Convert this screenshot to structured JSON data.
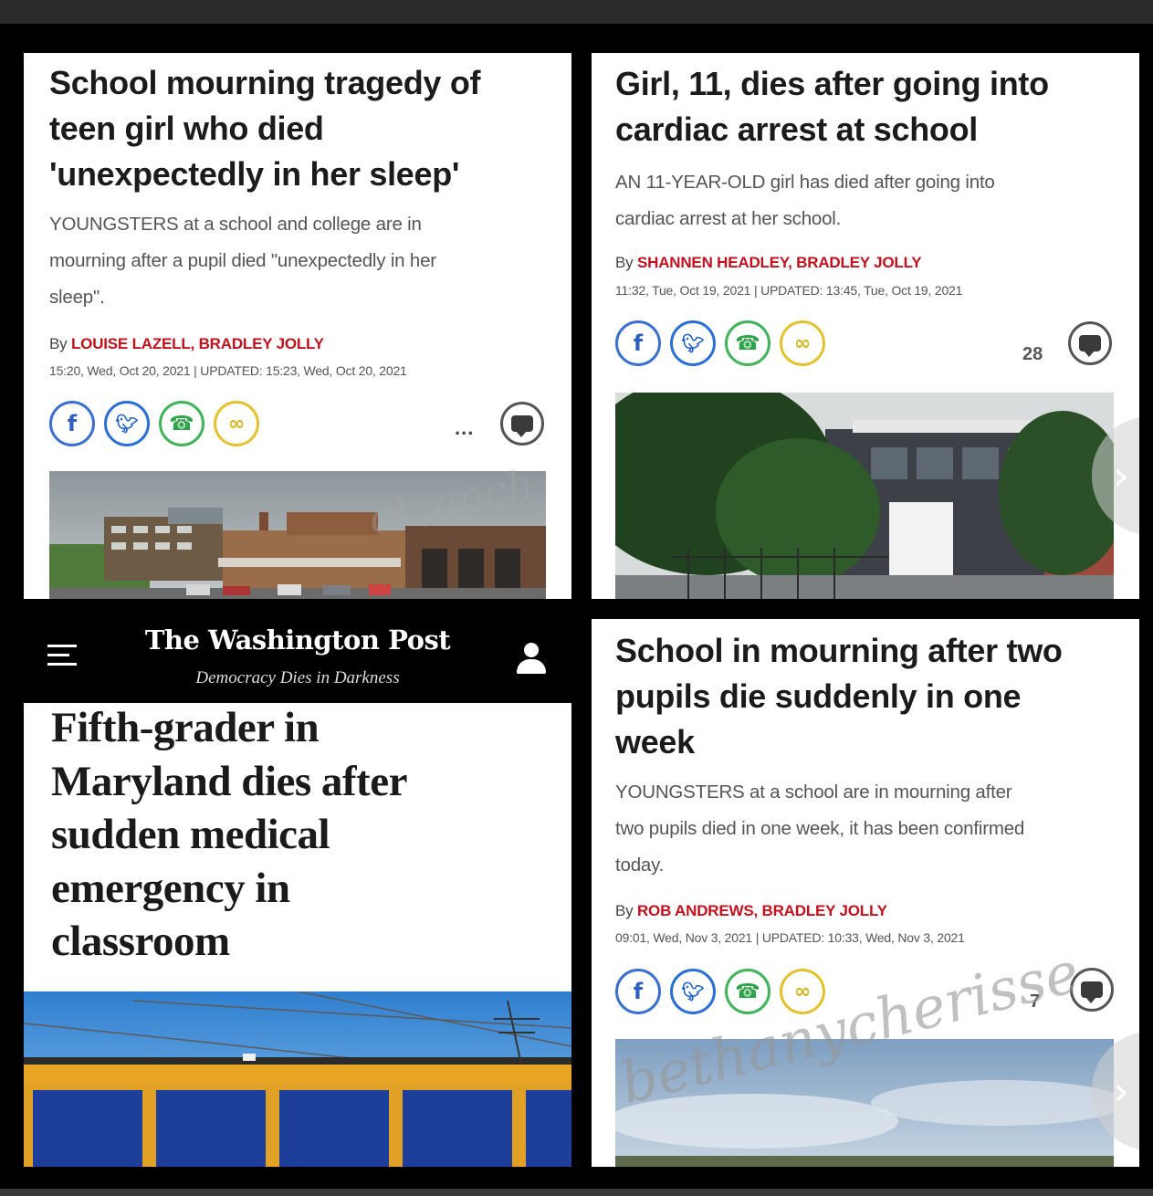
{
  "articles": [
    {
      "headline_lines": [
        "School mourning tragedy of",
        "teen girl who died",
        "'unexpectedly in her sleep'"
      ],
      "standfirst_lines": [
        "YOUNGSTERS at a school and college are in",
        "mourning after a pupil died \"unexpectedly in her",
        "sleep\"."
      ],
      "byline_prefix": "By",
      "authors": "LOUISE LAZELL, BRADLEY JOLLY",
      "timestamp": "15:20, Wed, Oct 20, 2021 | UPDATED: 15:23, Wed, Oct 20, 2021",
      "more": "...",
      "comment_count": ""
    },
    {
      "headline_lines": [
        "Girl, 11, dies after going into",
        "cardiac arrest at school"
      ],
      "standfirst_lines": [
        "AN 11-YEAR-OLD girl has died after going into",
        "cardiac arrest at her school."
      ],
      "byline_prefix": "By",
      "authors": "SHANNEN HEADLEY, BRADLEY JOLLY",
      "timestamp": "11:32, Tue, Oct 19, 2021 | UPDATED: 13:45, Tue, Oct 19, 2021",
      "comment_count": "28"
    },
    {
      "headline_lines": [
        "School in mourning after two",
        "pupils die suddenly in one",
        "week"
      ],
      "standfirst_lines": [
        "YOUNGSTERS at a school are in mourning after",
        "two pupils died in one week, it has been confirmed",
        "today."
      ],
      "byline_prefix": "By",
      "authors": "ROB ANDREWS, BRADLEY JOLLY",
      "timestamp": "09:01, Wed, Nov 3, 2021 | UPDATED: 10:33, Wed, Nov 3, 2021",
      "comment_count": "7"
    }
  ],
  "share_icons": [
    "facebook-icon",
    "twitter-icon",
    "whatsapp-icon",
    "link-icon"
  ],
  "washington_post": {
    "masthead": "The Washington Post",
    "tagline": "Democracy Dies in Darkness",
    "headline_lines": [
      "Fifth-grader in",
      "Maryland dies after",
      "sudden medical",
      "emergency in",
      "classroom"
    ]
  },
  "watermark": {
    "main": "bethanycherisse",
    "faint": "al      ,anch"
  },
  "colors": {
    "author_red": "#c4101d",
    "facebook": "#3b6fd1",
    "twitter": "#2a6fd6",
    "whatsapp": "#41b35b",
    "link": "#e4c22f"
  }
}
